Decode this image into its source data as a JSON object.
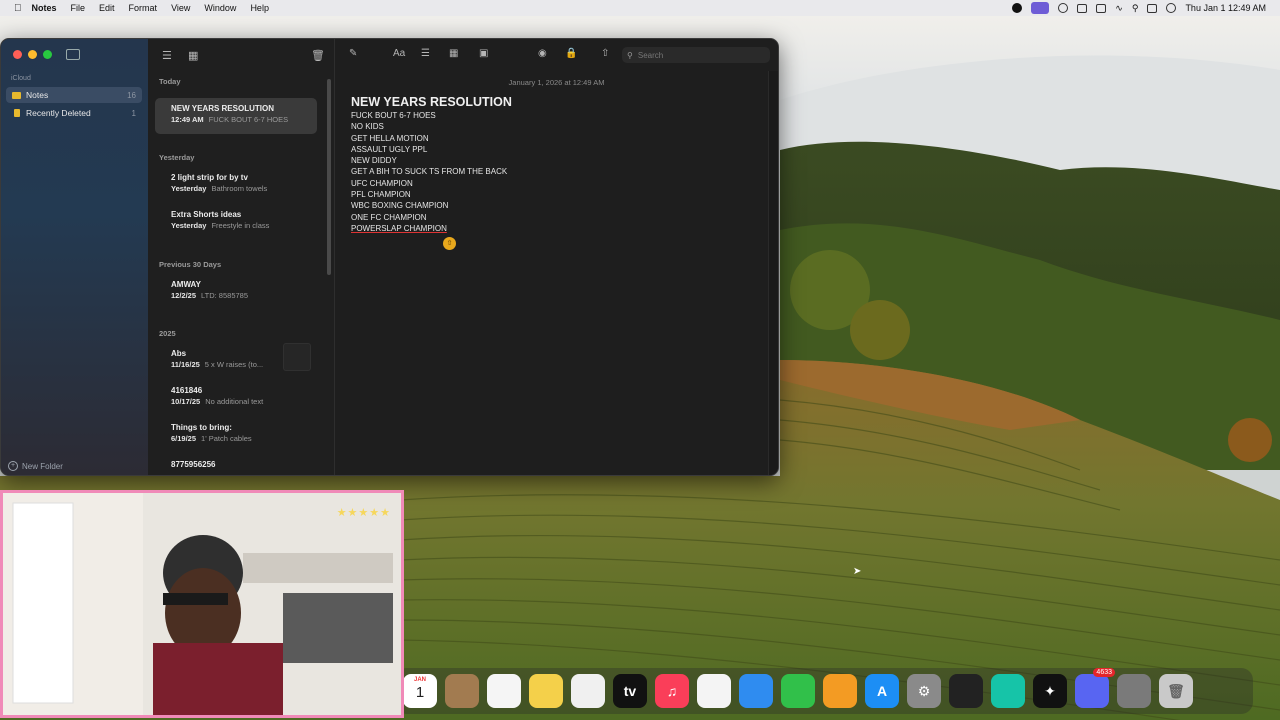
{
  "menubar": {
    "app_name": "Notes",
    "items": [
      "File",
      "Edit",
      "Format",
      "View",
      "Window",
      "Help"
    ],
    "clock": "Thu Jan 1  12:49 AM"
  },
  "sidebar": {
    "section": "iCloud",
    "folders": [
      {
        "label": "Notes",
        "count": "16"
      },
      {
        "label": "Recently Deleted",
        "count": "1"
      }
    ],
    "new_folder": "New Folder"
  },
  "list": {
    "groups": [
      "Today",
      "Yesterday",
      "Previous 30 Days",
      "2025"
    ],
    "notes": [
      {
        "title": "NEW YEARS RESOLUTION",
        "date": "12:49 AM",
        "preview": "FUCK BOUT 6-7 HOES"
      },
      {
        "title": "2 light strip for by tv",
        "date": "Yesterday",
        "preview": "Bathroom towels"
      },
      {
        "title": "Extra Shorts ideas",
        "date": "Yesterday",
        "preview": "Freestyle in class"
      },
      {
        "title": "AMWAY",
        "date": "12/2/25",
        "preview": "LTD: 8585785"
      },
      {
        "title": "Abs",
        "date": "11/16/25",
        "preview": "5 x W raises (to..."
      },
      {
        "title": "4161846",
        "date": "10/17/25",
        "preview": "No additional text"
      },
      {
        "title": "Things to bring:",
        "date": "6/19/25",
        "preview": "1' Patch cables"
      },
      {
        "title": "8775956256",
        "date": "",
        "preview": ""
      }
    ]
  },
  "editor": {
    "search_placeholder": "Search",
    "date": "January 1, 2026 at 12:49 AM",
    "title": "NEW YEARS RESOLUTION",
    "lines": [
      "FUCK BOUT 6-7 HOES",
      "NO KIDS",
      "GET HELLA MOTION",
      "ASSAULT UGLY PPL",
      "NEW DIDDY",
      "GET A BIH TO SUCK TS FROM THE BACK",
      "UFC CHAMPION",
      "PFL CHAMPION",
      "WBC BOXING CHAMPION",
      "ONE FC CHAMPION",
      "POWERSLAP CHAMPION"
    ]
  },
  "dock": {
    "calendar_month": "JAN",
    "calendar_day": "1",
    "discord_badge": "4633"
  },
  "colors": {
    "accent_yellow": "#e7b92e",
    "sidebar_blue": "#24364d",
    "webcam_border": "#f08ab8"
  }
}
